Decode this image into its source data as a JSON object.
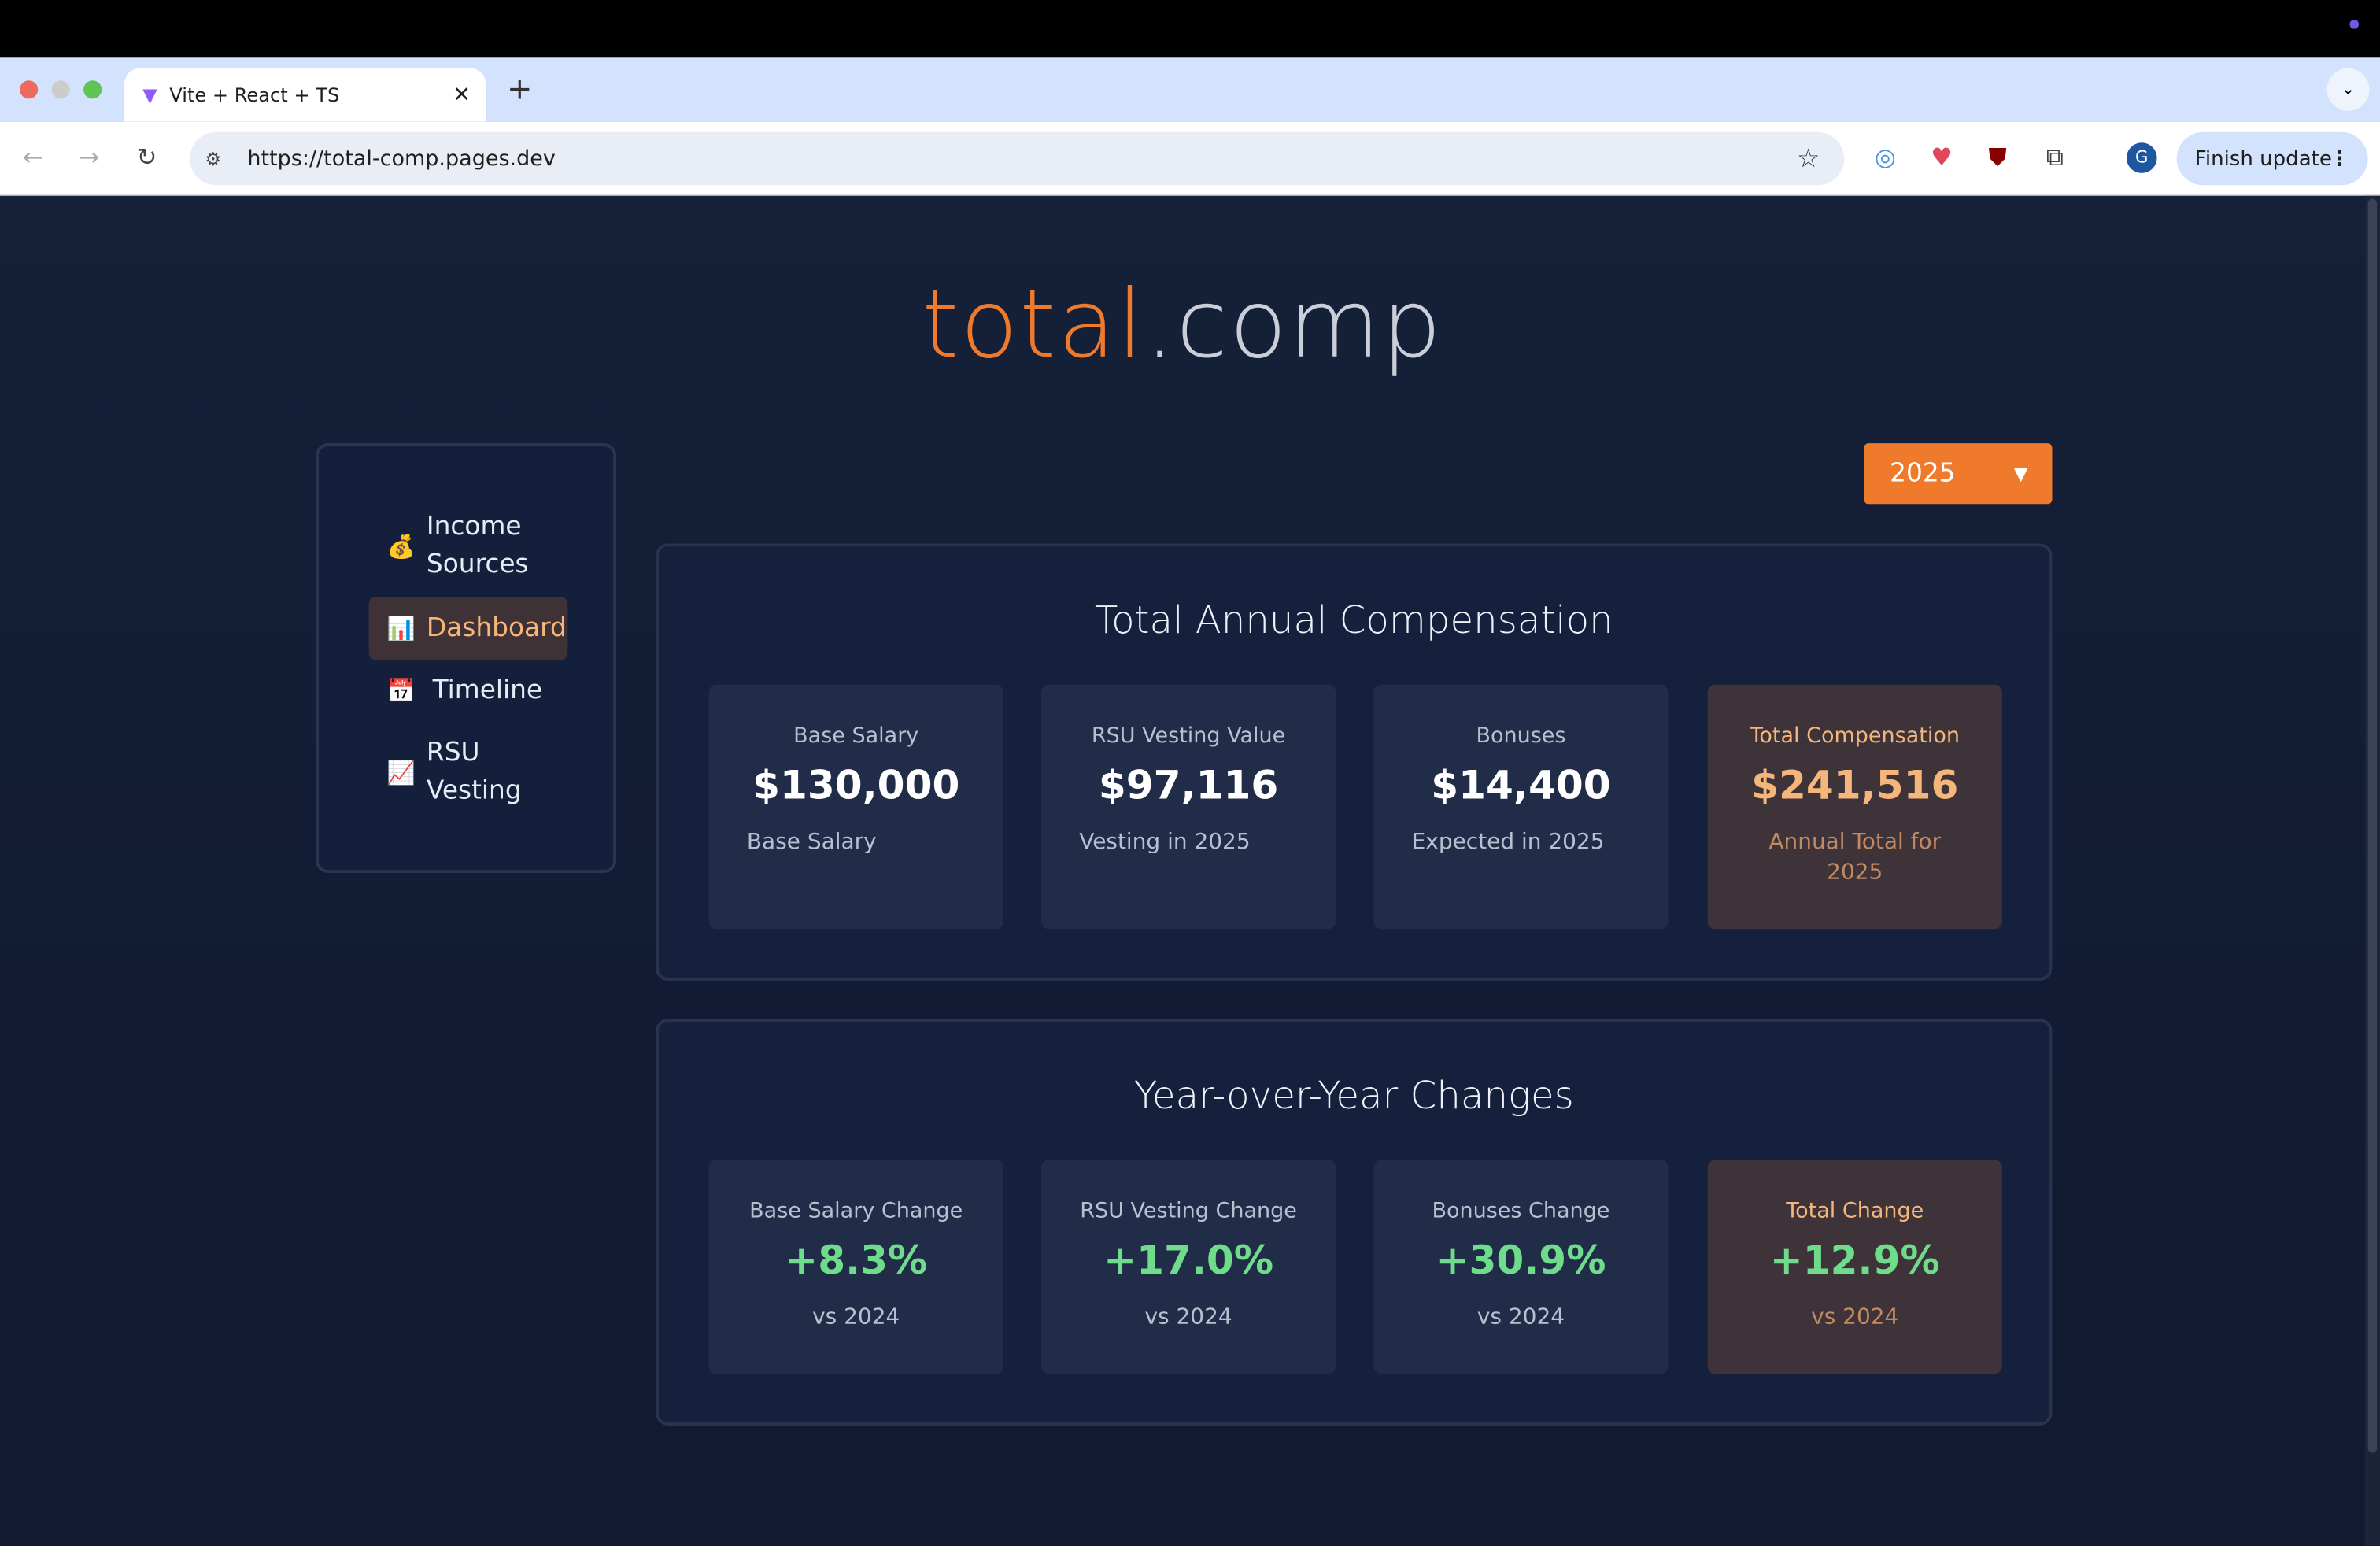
{
  "browser": {
    "tab_title": "Vite + React + TS",
    "url": "https://total-comp.pages.dev",
    "finish_update": "Finish update",
    "profile_initial": "G"
  },
  "logo": {
    "part1": "total",
    "part2": ".comp"
  },
  "sidebar": {
    "items": [
      {
        "icon": "money-bag-icon",
        "glyph": "💰",
        "label": "Income Sources",
        "active": false
      },
      {
        "icon": "bar-chart-icon",
        "glyph": "📊",
        "label": "Dashboard",
        "active": true
      },
      {
        "icon": "calendar-icon",
        "glyph": "📅",
        "label": "Timeline",
        "active": false
      },
      {
        "icon": "chart-increasing-icon",
        "glyph": "📈",
        "label": "RSU Vesting",
        "active": false
      }
    ]
  },
  "year_select": {
    "value": "2025"
  },
  "compensation": {
    "title": "Total Annual Compensation",
    "cards": [
      {
        "label": "Base Salary",
        "value": "$130,000",
        "sub": "Base Salary"
      },
      {
        "label": "RSU Vesting Value",
        "value": "$97,116",
        "sub": "Vesting in 2025"
      },
      {
        "label": "Bonuses",
        "value": "$14,400",
        "sub": "Expected in 2025"
      },
      {
        "label": "Total Compensation",
        "value": "$241,516",
        "sub": "Annual Total for 2025"
      }
    ]
  },
  "yoy": {
    "title": "Year-over-Year Changes",
    "cards": [
      {
        "label": "Base Salary Change",
        "value": "+8.3%",
        "sub": "vs 2024"
      },
      {
        "label": "RSU Vesting Change",
        "value": "+17.0%",
        "sub": "vs 2024"
      },
      {
        "label": "Bonuses Change",
        "value": "+30.9%",
        "sub": "vs 2024"
      },
      {
        "label": "Total Change",
        "value": "+12.9%",
        "sub": "vs 2024"
      }
    ]
  },
  "colors": {
    "accent": "#f07a2b",
    "positive": "#6fdc8c",
    "background": "#121b33"
  }
}
